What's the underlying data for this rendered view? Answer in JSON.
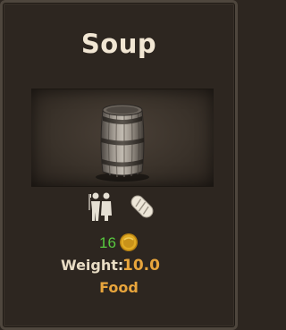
{
  "item": {
    "name": "Soup",
    "image_icon": "barrel-icon",
    "price": "16",
    "price_icon": "gold-coin-icon",
    "weight_label": "Weight:",
    "weight_value": "10.0",
    "category": "Food"
  },
  "traits": [
    {
      "icon": "citizens-icon"
    },
    {
      "icon": "bread-icon"
    }
  ],
  "colors": {
    "panel_bg": "#2d2620",
    "panel_border": "#4e463d",
    "title": "#f1e6d3",
    "price": "#58c93f",
    "weight_value": "#e8a53c",
    "category": "#e8a53c",
    "coin": "#d9a21b"
  }
}
